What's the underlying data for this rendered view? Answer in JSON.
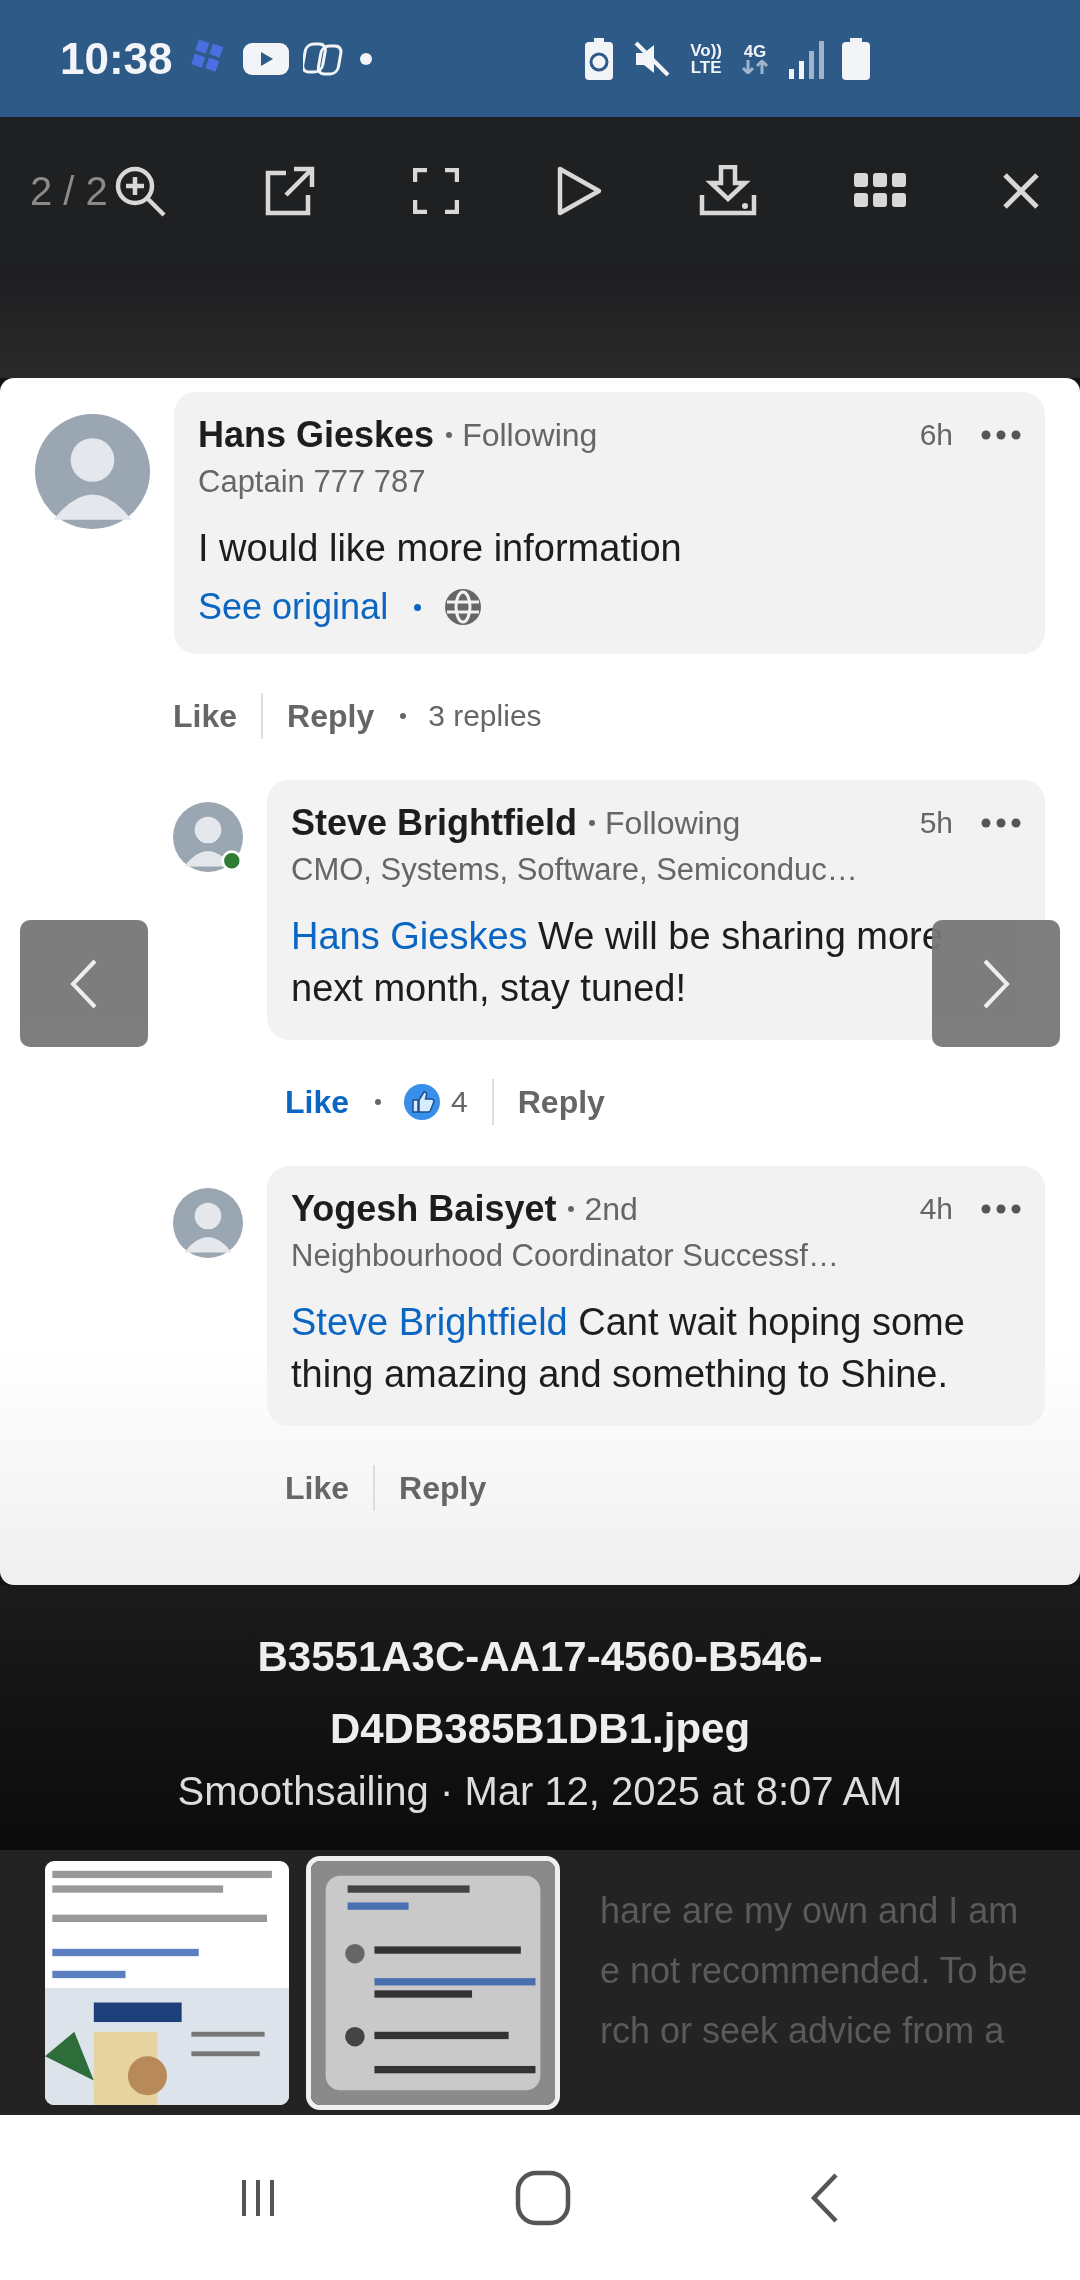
{
  "status_bar": {
    "time": "10:38",
    "volte_top": "Vo))",
    "volte_bottom": "LTE",
    "network_type": "4G"
  },
  "toolbar": {
    "counter": "2 / 2"
  },
  "comments": [
    {
      "name": "Hans Gieskes",
      "relation": "Following",
      "headline": "Captain 777 787",
      "time": "6h",
      "text": "I would like more information",
      "see_original": "See original",
      "online": false,
      "like": "Like",
      "liked": false,
      "reply": "Reply",
      "replies_count": "3 replies",
      "replies": [
        {
          "name": "Steve Brightfield",
          "relation": "Following",
          "headline": "CMO, Systems, Software, Semiconduc…",
          "time": "5h",
          "mention": "Hans Gieskes",
          "text": "We will be sharing more next month, stay tuned!",
          "online": true,
          "like": "Like",
          "liked": true,
          "reactions": "4",
          "reply": "Reply"
        },
        {
          "name": "Yogesh Baisyet",
          "relation": "2nd",
          "headline": "Neighbourhood Coordinator Successf…",
          "time": "4h",
          "mention": "Steve Brightfield",
          "text": "Cant wait hoping some thing amazing and something to Shine.",
          "online": false,
          "like": "Like",
          "liked": false,
          "reply": "Reply"
        }
      ]
    }
  ],
  "caption": {
    "title": "B3551A3C-AA17-4560-B546-D4DB385B1DB1.jpeg",
    "subtitle": "Smoothsailing · Mar 12, 2025 at 8:07 AM"
  },
  "description_lines": [
    "hare are my own and I am",
    "e not recommended. To be",
    "rch or seek advice from a"
  ],
  "thumbnails": [
    {
      "kind": "picture",
      "selected": false
    },
    {
      "kind": "picture",
      "selected": true
    }
  ]
}
